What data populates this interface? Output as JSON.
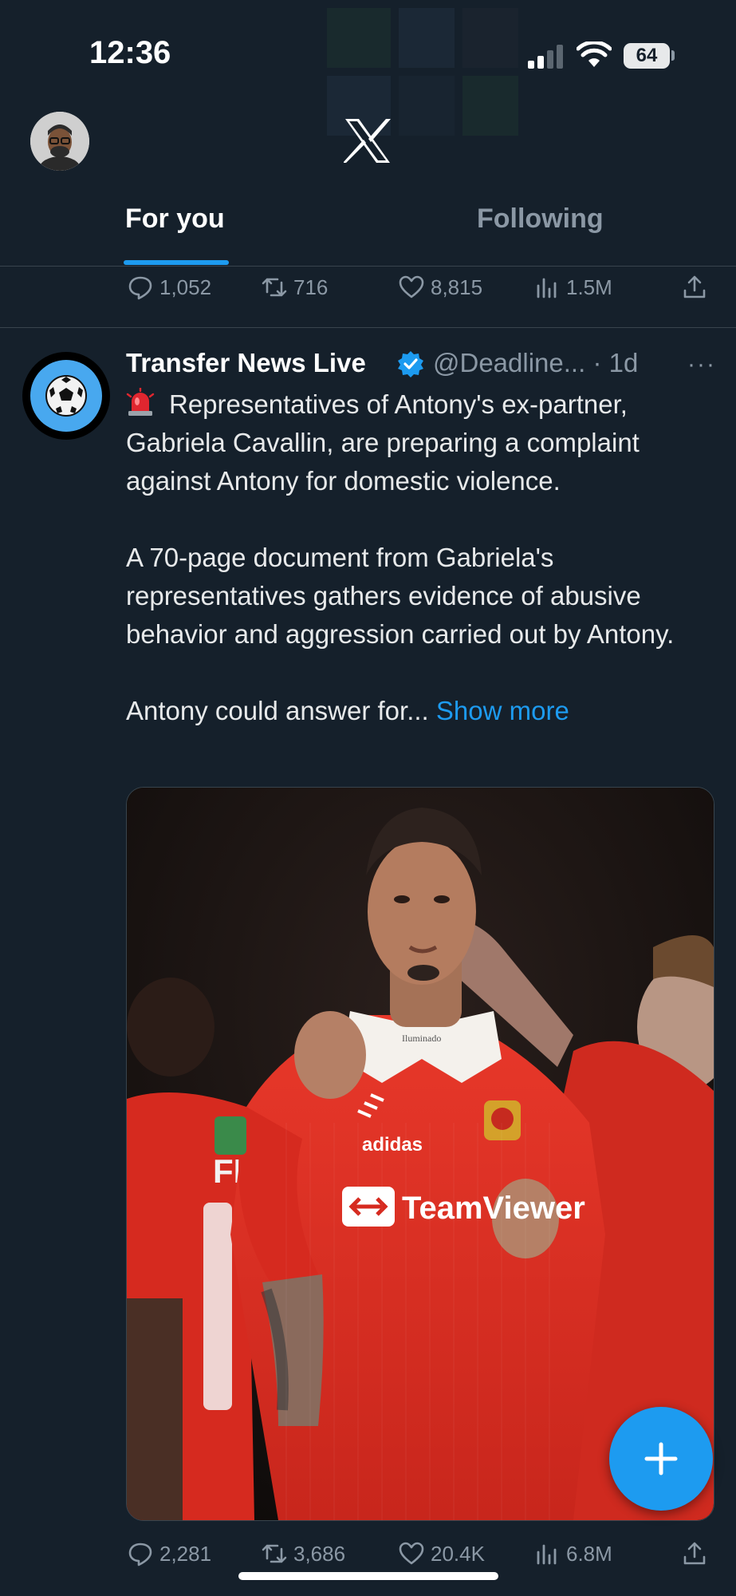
{
  "status_bar": {
    "time": "12:36",
    "battery": "64"
  },
  "header": {
    "logo_icon": "x-logo-icon"
  },
  "tabs": [
    {
      "label": "For you",
      "active": true
    },
    {
      "label": "Following",
      "active": false
    }
  ],
  "previous_tweet_actions": {
    "replies": "1,052",
    "reposts": "716",
    "likes": "8,815",
    "views": "1.5M"
  },
  "tweet": {
    "author_name": "Transfer News Live",
    "verified": true,
    "handle": "@Deadline...",
    "time": "· 1d",
    "more_label": "···",
    "paragraph1": "Representatives of Antony's ex-partner, Gabriela Cavallin, are preparing a complaint against Antony for domestic violence.",
    "paragraph2": "A 70-page document from Gabriela's representatives gathers evidence of abusive behavior and aggression carried out by Antony.",
    "paragraph3": "Antony could answer for...",
    "show_more": "Show more",
    "media_text": {
      "brand_left": "adidas",
      "brand_right": "TeamViewer",
      "collar": "Iluminado"
    },
    "actions": {
      "replies": "2,281",
      "reposts": "3,686",
      "likes": "20.4K",
      "views": "6.8M"
    }
  },
  "fab": {
    "icon": "plus-icon"
  },
  "colors": {
    "background": "#15202b",
    "accent": "#1d9bf0",
    "muted": "#8b98a5",
    "text": "#e7e9ea"
  }
}
